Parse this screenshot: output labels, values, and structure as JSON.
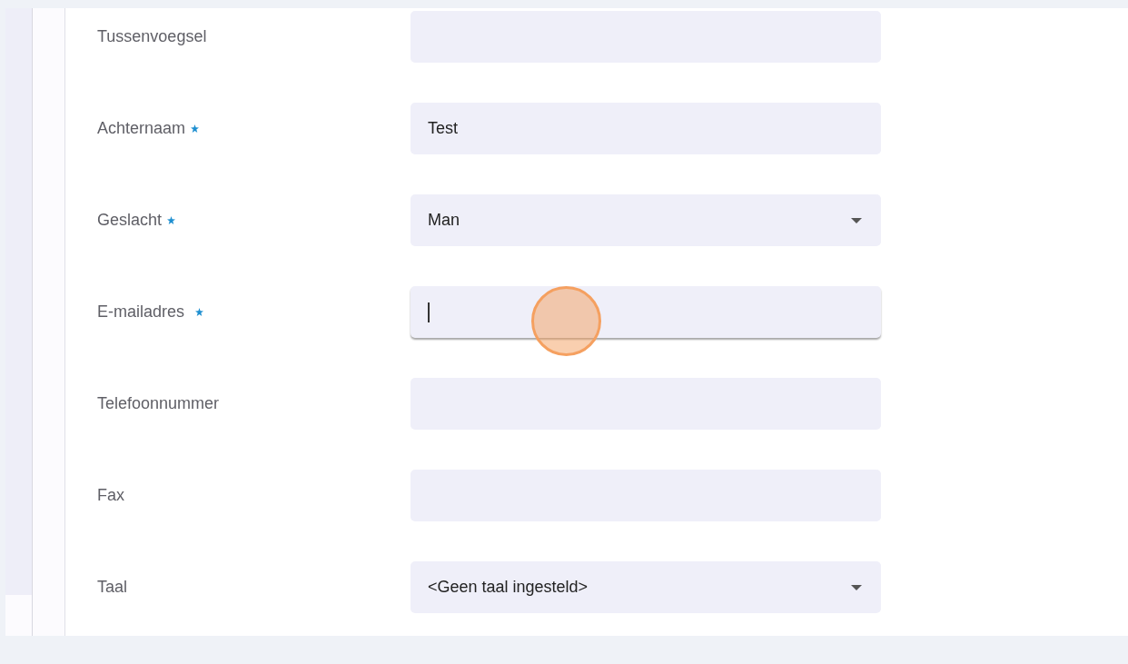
{
  "fields": [
    {
      "label": "Tussenvoegsel",
      "kind": "text",
      "required": false,
      "focused": false
    },
    {
      "label": "Achternaam",
      "kind": "text",
      "required": true,
      "value": "Test",
      "focused": false
    },
    {
      "label": "Geslacht",
      "kind": "select",
      "required": true,
      "value": "Man",
      "focused": false
    },
    {
      "label": "E-mailadres",
      "kind": "text",
      "required": true,
      "focused": true
    },
    {
      "label": "Telefoonnummer",
      "kind": "text",
      "required": false,
      "focused": false
    },
    {
      "label": "Fax",
      "kind": "text",
      "required": false,
      "focused": false
    },
    {
      "label": "Taal",
      "kind": "select",
      "required": false,
      "value": "<Geen taal ingesteld>",
      "focused": false
    }
  ],
  "click_marker": true
}
